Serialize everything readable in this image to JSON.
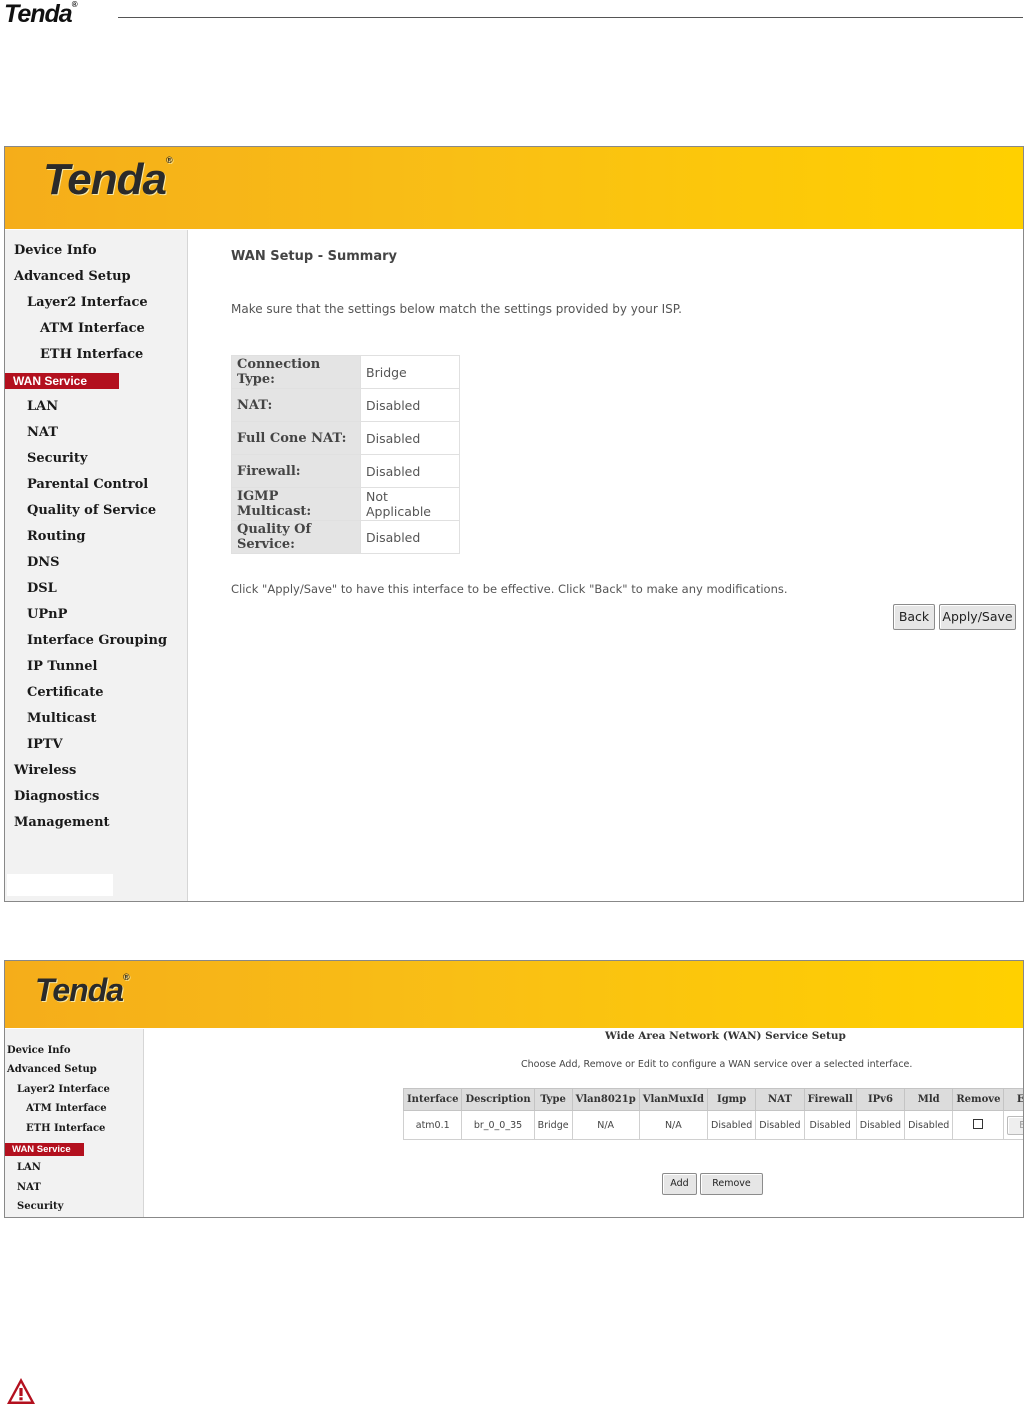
{
  "document": {
    "logo": "Tenda",
    "logo_mark": "®"
  },
  "screenshot1": {
    "brand": "Tenda",
    "brand_mark": "®",
    "nav": [
      {
        "label": "Device Info"
      },
      {
        "label": "Advanced Setup"
      },
      {
        "label": "Layer2 Interface"
      },
      {
        "label": "ATM Interface"
      },
      {
        "label": "ETH Interface"
      },
      {
        "label": "WAN Service"
      },
      {
        "label": "LAN"
      },
      {
        "label": "NAT"
      },
      {
        "label": "Security"
      },
      {
        "label": "Parental Control"
      },
      {
        "label": "Quality of Service"
      },
      {
        "label": "Routing"
      },
      {
        "label": "DNS"
      },
      {
        "label": "DSL"
      },
      {
        "label": "UPnP"
      },
      {
        "label": "Interface Grouping"
      },
      {
        "label": "IP Tunnel"
      },
      {
        "label": "Certificate"
      },
      {
        "label": "Multicast"
      },
      {
        "label": "IPTV"
      },
      {
        "label": "Wireless"
      },
      {
        "label": "Diagnostics"
      },
      {
        "label": "Management"
      }
    ],
    "active_nav": "WAN Service",
    "page_title": "WAN Setup - Summary",
    "intro": "Make sure that the settings below match the settings provided by your ISP.",
    "summary": [
      {
        "key": "Connection Type:",
        "value": "Bridge"
      },
      {
        "key": "NAT:",
        "value": "Disabled"
      },
      {
        "key": "Full Cone NAT:",
        "value": "Disabled"
      },
      {
        "key": "Firewall:",
        "value": "Disabled"
      },
      {
        "key": "IGMP Multicast:",
        "value": "Not Applicable"
      },
      {
        "key": "Quality Of Service:",
        "value": "Disabled"
      }
    ],
    "note": "Click \"Apply/Save\" to have this interface to be effective. Click \"Back\" to make any modifications.",
    "back_label": "Back",
    "apply_label": "Apply/Save"
  },
  "screenshot2": {
    "brand": "Tenda",
    "brand_mark": "®",
    "nav": [
      {
        "label": "Device Info"
      },
      {
        "label": "Advanced Setup"
      },
      {
        "label": "Layer2 Interface"
      },
      {
        "label": "ATM Interface"
      },
      {
        "label": "ETH Interface"
      },
      {
        "label": "WAN Service"
      },
      {
        "label": "LAN"
      },
      {
        "label": "NAT"
      },
      {
        "label": "Security"
      }
    ],
    "active_nav": "WAN Service",
    "page_title": "Wide Area Network (WAN) Service Setup",
    "intro": "Choose Add, Remove or Edit to configure a WAN service over a selected interface.",
    "columns": [
      "Interface",
      "Description",
      "Type",
      "Vlan8021p",
      "VlanMuxId",
      "Igmp",
      "NAT",
      "Firewall",
      "IPv6",
      "Mld",
      "Remove",
      "Edit"
    ],
    "rows": [
      {
        "interface": "atm0.1",
        "description": "br_0_0_35",
        "type": "Bridge",
        "vlan8021p": "N/A",
        "vlanmuxid": "N/A",
        "igmp": "Disabled",
        "nat": "Disabled",
        "firewall": "Disabled",
        "ipv6": "Disabled",
        "mld": "Disabled",
        "remove_checked": false,
        "edit_label": "Edit"
      }
    ],
    "add_label": "Add",
    "remove_label": "Remove"
  },
  "colors": {
    "banner_start": "#f5ad1a",
    "banner_end": "#ffd000",
    "active_nav": "#b3101e",
    "warning": "#b3101e"
  },
  "warning_icon": "warning-triangle-icon"
}
